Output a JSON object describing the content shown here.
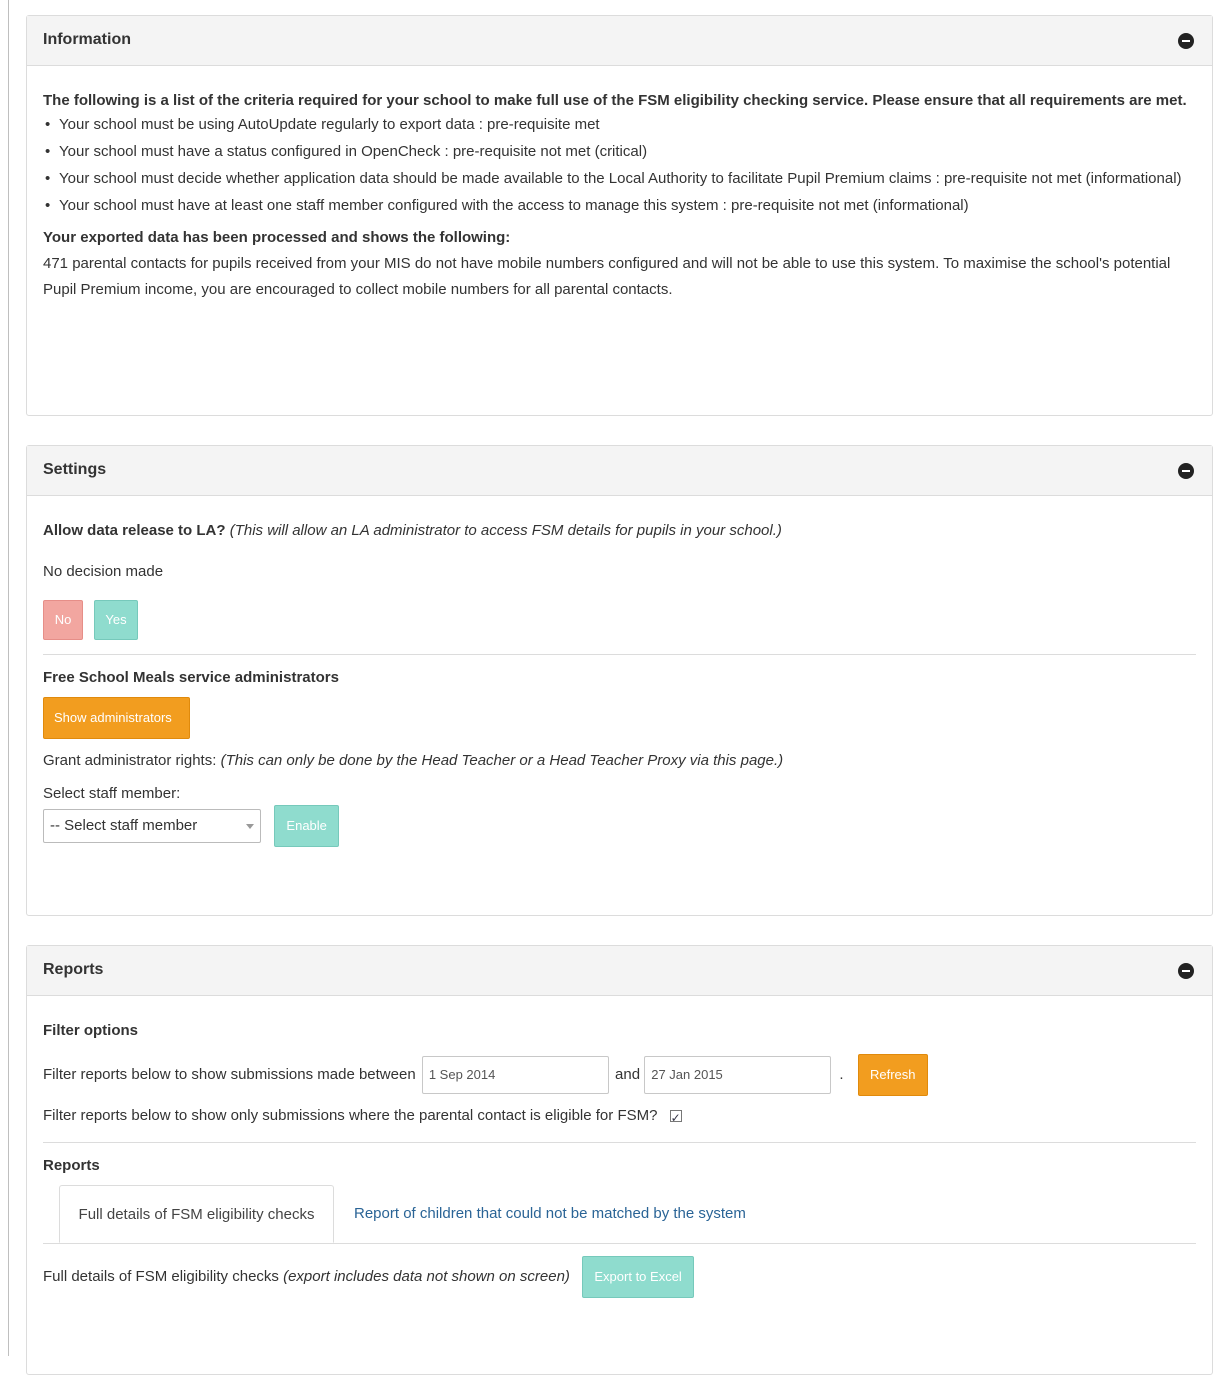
{
  "information": {
    "title": "Information",
    "intro": "The following is a list of the criteria required for your school to make full use of the FSM eligibility checking service. Please ensure that all requirements are met.",
    "criteria": [
      "Your school must be using AutoUpdate regularly to export data : pre-requisite met",
      "Your school must have a status configured in OpenCheck : pre-requisite not met (critical)",
      "Your school must decide whether application data should be made available to the Local Authority to facilitate Pupil Premium claims : pre-requisite not met (informational)",
      "Your school must have at least one staff member configured with the access to manage this system : pre-requisite not met (informational)"
    ],
    "exported_title": "Your exported data has been processed and shows the following:",
    "exported_text": "471 parental contacts for pupils received from your MIS do not have mobile numbers configured and will not be able to use this system. To maximise the school's potential Pupil Premium income, you are encouraged to collect mobile numbers for all parental contacts."
  },
  "settings": {
    "title": "Settings",
    "allow_label": "Allow data release to LA?",
    "allow_note": "(This will allow an LA administrator to access FSM details for pupils in your school.)",
    "decision_status": "No decision made",
    "no_label": "No",
    "yes_label": "Yes",
    "admins_title": "Free School Meals service administrators",
    "show_admins_label": "Show administrators",
    "grant_label": "Grant administrator rights:",
    "grant_note": "(This can only be done by the Head Teacher or a Head Teacher Proxy via this page.)",
    "select_label": "Select staff member:",
    "select_value": "-- Select staff member",
    "enable_label": "Enable"
  },
  "reports": {
    "title": "Reports",
    "filter_title": "Filter options",
    "filter_text": "Filter reports below to show submissions made between",
    "date_from": "1 Sep 2014",
    "and_label": "and",
    "date_to": "27 Jan 2015",
    "period": ".",
    "refresh_label": "Refresh",
    "eligible_text": "Filter reports below to show only submissions where the parental contact is eligible for FSM?",
    "eligible_checked": true,
    "reports_subtitle": "Reports",
    "tabs": [
      {
        "label": "Full details of FSM eligibility checks",
        "active": true
      },
      {
        "label": "Report of children that could not be matched by the system",
        "active": false
      }
    ],
    "export_text": "Full details of FSM eligibility checks",
    "export_note": "(export includes data not shown on screen)",
    "export_label": "Export to Excel"
  },
  "colors": {
    "orange": "#f29d1f",
    "teal": "#8fdcce",
    "red_light": "#f2a6a0",
    "link": "#2a6496"
  }
}
